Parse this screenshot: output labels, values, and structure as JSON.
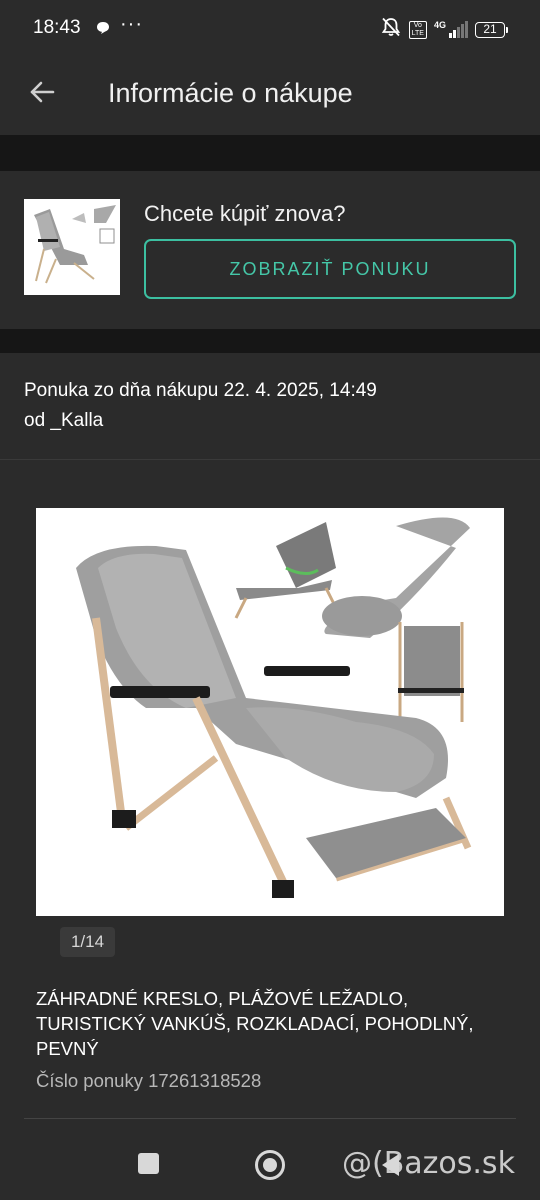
{
  "status_bar": {
    "time": "18:43",
    "dots": "···",
    "volte": "Vo\nLTE",
    "network": "4G",
    "battery": "21"
  },
  "header": {
    "title": "Informácie o nákupe",
    "back_icon": "arrow-left-icon"
  },
  "rebuy": {
    "question": "Chcete kúpiť znova?",
    "button_label": "ZOBRAZIŤ PONUKU",
    "accent_color": "#3cbfa1"
  },
  "offer": {
    "date_prefix": "Ponuka zo dňa nákupu",
    "date_value": " 22. 4. 2025, 14:49",
    "seller": "od _Kalla",
    "image_counter": "1/14",
    "product_title": "ZÁHRADNÉ KRESLO, PLÁŽOVÉ LEŽADLO, TURISTICKÝ VANKÚŠ, ROZKLADACÍ, POHODLNÝ, PEVNÝ",
    "offer_number": "Číslo ponuky 17261318528"
  },
  "nav": {
    "watermark": "@(Bazos.sk"
  }
}
